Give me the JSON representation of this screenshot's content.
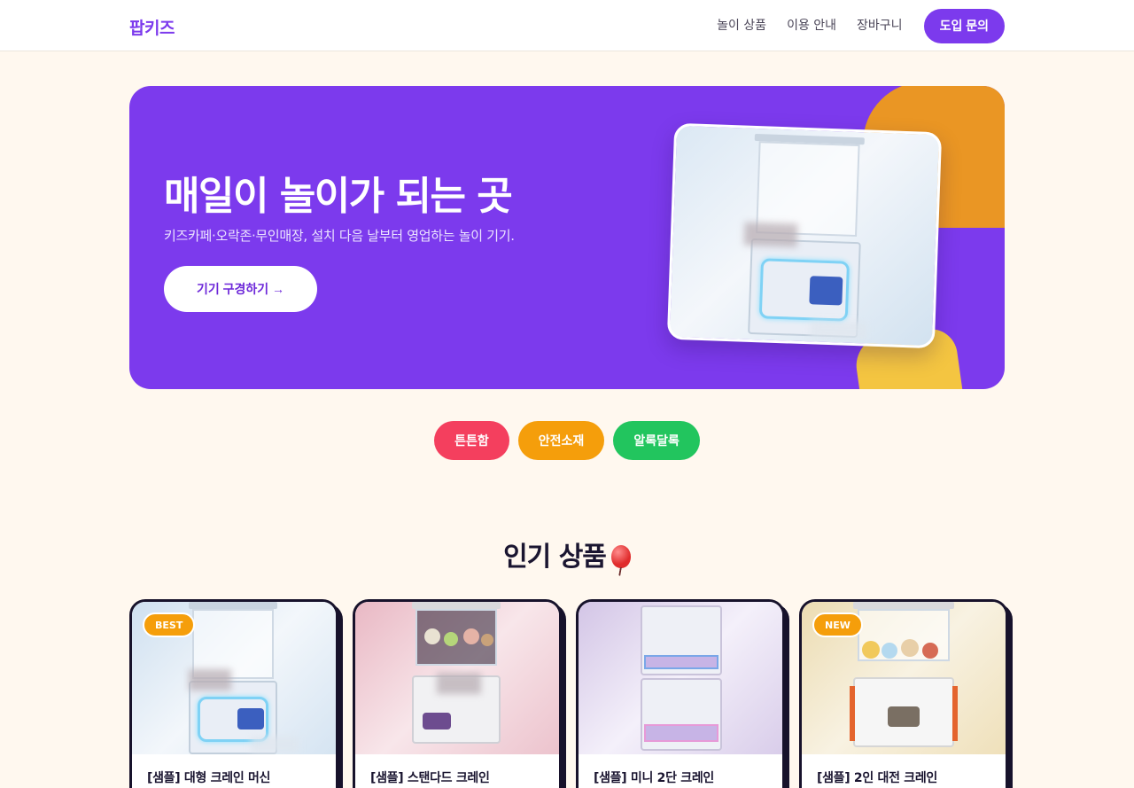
{
  "brand": {
    "logo": "팝키즈",
    "accent": "#7c3aed"
  },
  "nav": {
    "links": [
      "놀이 상품",
      "이용 안내",
      "장바구니"
    ],
    "cta": "도입 문의"
  },
  "hero": {
    "title": "매일이 놀이가 되는 곳",
    "subtitle": "키즈카페·오락존·무인매장, 설치 다음 날부터 영업하는 놀이 기기.",
    "button": "기기 구경하기 →",
    "background": "#7c3aed",
    "image_icon": "claw-machine-photo"
  },
  "chips": [
    {
      "label": "튼튼함",
      "color": "#f43f5e"
    },
    {
      "label": "안전소재",
      "color": "#f59e0b"
    },
    {
      "label": "알록달록",
      "color": "#22c55e"
    }
  ],
  "section": {
    "title": "인기 상품",
    "icon": "balloon-icon"
  },
  "products": [
    {
      "name": "[샘플] 대형 크레인 머신",
      "badge": "BEST",
      "tint": "#d9e8f5"
    },
    {
      "name": "[샘플] 스탠다드 크레인",
      "badge": "",
      "tint": "#f2cdd6"
    },
    {
      "name": "[샘플] 미니 2단 크레인",
      "badge": "",
      "tint": "#ddd2ec"
    },
    {
      "name": "[샘플] 2인 대전 크레인",
      "badge": "NEW",
      "tint": "#efe4c6"
    }
  ]
}
